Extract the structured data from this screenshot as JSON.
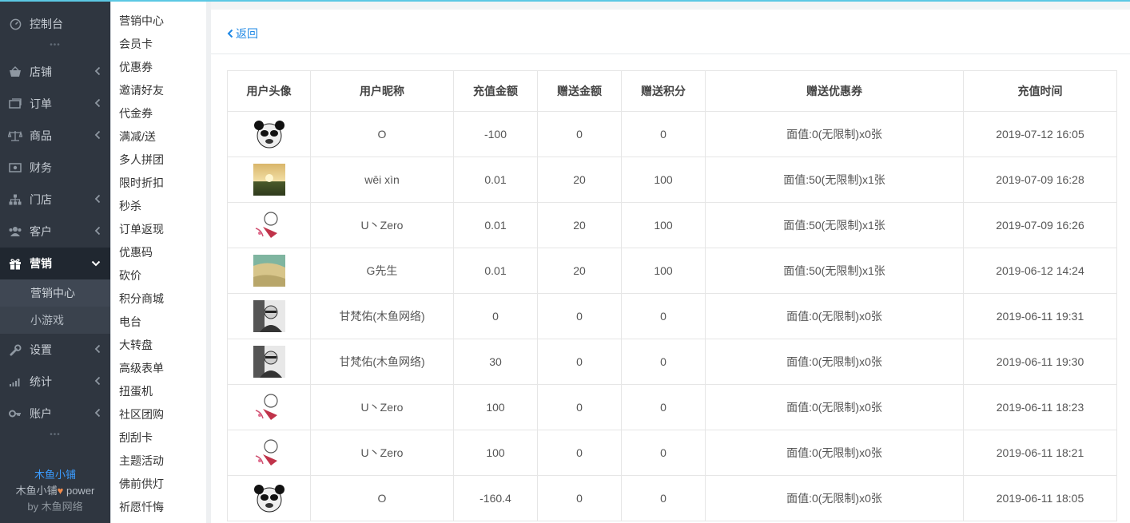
{
  "colors": {
    "accent": "#1e88e5",
    "sidebar_bg": "#2f3640",
    "topline": "#5bc8e4"
  },
  "sidebar": {
    "items": [
      {
        "label": "控制台",
        "icon": "dashboard-icon"
      },
      {
        "label": "店铺",
        "icon": "shop-icon"
      },
      {
        "label": "订单",
        "icon": "order-icon"
      },
      {
        "label": "商品",
        "icon": "scale-icon"
      },
      {
        "label": "财务",
        "icon": "money-icon"
      },
      {
        "label": "门店",
        "icon": "sitemap-icon"
      },
      {
        "label": "客户",
        "icon": "users-icon"
      },
      {
        "label": "营销",
        "icon": "gift-icon"
      },
      {
        "label": "设置",
        "icon": "wrench-icon"
      },
      {
        "label": "统计",
        "icon": "signal-icon"
      },
      {
        "label": "账户",
        "icon": "key-icon"
      }
    ],
    "sub_items": [
      "营销中心",
      "小游戏"
    ],
    "brand": {
      "name": "木鱼小铺",
      "line2_a": "木鱼小铺",
      "line2_b": "power",
      "line3_a": "by",
      "line3_b": "木鱼网络"
    }
  },
  "subnav": {
    "items": [
      "营销中心",
      "会员卡",
      "优惠券",
      "邀请好友",
      "代金券",
      "满减/送",
      "多人拼团",
      "限时折扣",
      "秒杀",
      "订单返现",
      "优惠码",
      "砍价",
      "积分商城",
      "电台",
      "大转盘",
      "高级表单",
      "扭蛋机",
      "社区团购",
      "刮刮卡",
      "主题活动",
      "佛前供灯",
      "祈愿忏悔"
    ]
  },
  "main": {
    "back_label": "返回",
    "table": {
      "headers": [
        "用户头像",
        "用户昵称",
        "充值金额",
        "赠送金额",
        "赠送积分",
        "赠送优惠券",
        "充值时间"
      ],
      "rows": [
        {
          "avatar": "panda",
          "nickname": "O",
          "amount": "-100",
          "bonus": "0",
          "points": "0",
          "coupon": "面值:0(无限制)x0张",
          "time": "2019-07-12 16:05"
        },
        {
          "avatar": "sunset",
          "nickname": "wēi xìn",
          "amount": "0.01",
          "bonus": "20",
          "points": "100",
          "coupon": "面值:50(无限制)x1张",
          "time": "2019-07-09 16:28"
        },
        {
          "avatar": "cartoon",
          "nickname": "U丶Zero",
          "amount": "0.01",
          "bonus": "20",
          "points": "100",
          "coupon": "面值:50(无限制)x1张",
          "time": "2019-07-09 16:26"
        },
        {
          "avatar": "beach",
          "nickname": "G先生",
          "amount": "0.01",
          "bonus": "20",
          "points": "100",
          "coupon": "面值:50(无限制)x1张",
          "time": "2019-06-12 14:24"
        },
        {
          "avatar": "person",
          "nickname": "甘梵佑(木鱼网络)",
          "amount": "0",
          "bonus": "0",
          "points": "0",
          "coupon": "面值:0(无限制)x0张",
          "time": "2019-06-11 19:31"
        },
        {
          "avatar": "person",
          "nickname": "甘梵佑(木鱼网络)",
          "amount": "30",
          "bonus": "0",
          "points": "0",
          "coupon": "面值:0(无限制)x0张",
          "time": "2019-06-11 19:30"
        },
        {
          "avatar": "cartoon",
          "nickname": "U丶Zero",
          "amount": "100",
          "bonus": "0",
          "points": "0",
          "coupon": "面值:0(无限制)x0张",
          "time": "2019-06-11 18:23"
        },
        {
          "avatar": "cartoon",
          "nickname": "U丶Zero",
          "amount": "100",
          "bonus": "0",
          "points": "0",
          "coupon": "面值:0(无限制)x0张",
          "time": "2019-06-11 18:21"
        },
        {
          "avatar": "panda",
          "nickname": "O",
          "amount": "-160.4",
          "bonus": "0",
          "points": "0",
          "coupon": "面值:0(无限制)x0张",
          "time": "2019-06-11 18:05"
        }
      ]
    }
  }
}
